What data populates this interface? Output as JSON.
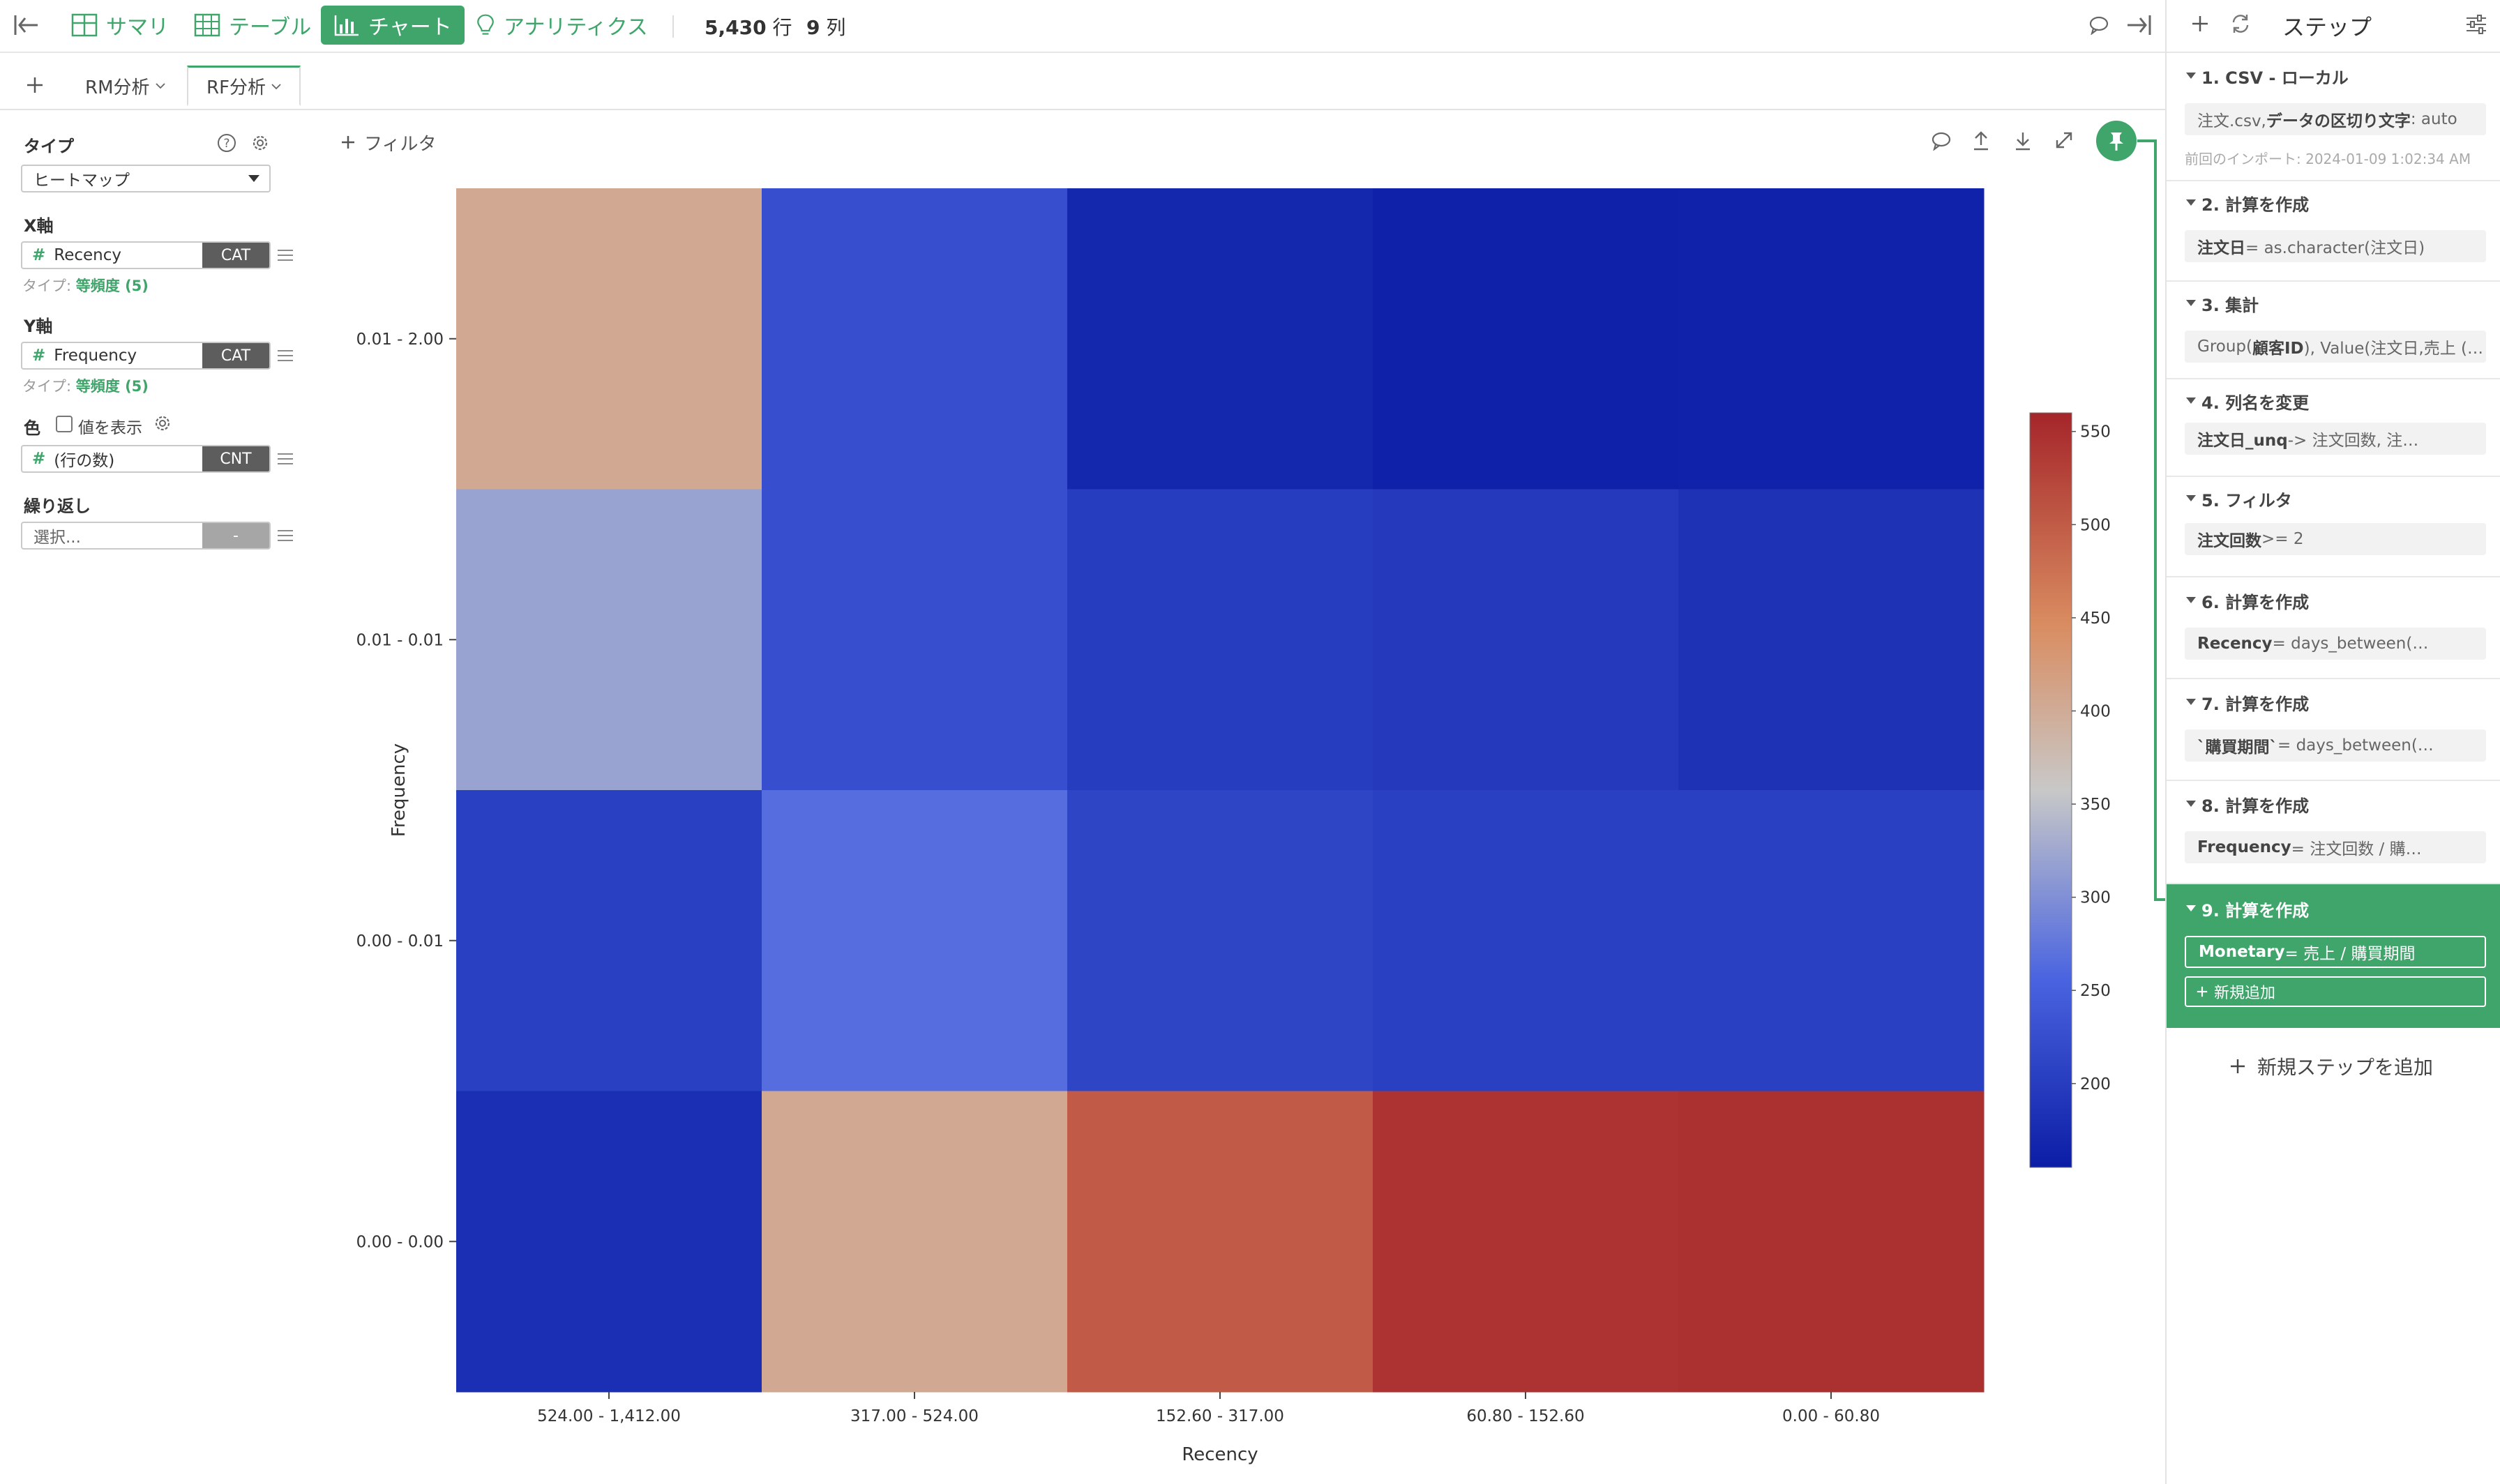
{
  "toolbar": {
    "nav": [
      {
        "label": "サマリ",
        "icon": "summary-icon"
      },
      {
        "label": "テーブル",
        "icon": "table-icon"
      },
      {
        "label": "チャート",
        "icon": "chart-icon",
        "active": true
      },
      {
        "label": "アナリティクス",
        "icon": "lightbulb-icon"
      }
    ],
    "rows_value": "5,430",
    "rows_unit": "行",
    "cols_value": "9",
    "cols_unit": "列"
  },
  "tabs": [
    {
      "label": "RM分析"
    },
    {
      "label": "RF分析",
      "active": true
    }
  ],
  "config": {
    "type_label": "タイプ",
    "type_value": "ヒートマップ",
    "x_label": "X軸",
    "x_field": "Recency",
    "x_tag": "CAT",
    "x_sub_prefix": "タイプ:",
    "x_sub_value": "等頻度 (5)",
    "y_label": "Y軸",
    "y_field": "Frequency",
    "y_tag": "CAT",
    "y_sub_prefix": "タイプ:",
    "y_sub_value": "等頻度 (5)",
    "color_label": "色",
    "show_values_label": "値を表示",
    "color_field": "(行の数)",
    "color_tag": "CNT",
    "repeat_label": "繰り返し",
    "repeat_placeholder": "選択...",
    "repeat_tag": "-"
  },
  "chart_toolbar": {
    "filter_label": "フィルタ"
  },
  "chart_data": {
    "type": "heatmap",
    "xlabel": "Recency",
    "ylabel": "Frequency",
    "x_categories": [
      "524.00 - 1,412.00",
      "317.00 - 524.00",
      "152.60 - 317.00",
      "60.80 - 152.60",
      "0.00 - 60.80"
    ],
    "y_categories": [
      "0.01 - 2.00",
      "0.01 - 0.01",
      "0.00 - 0.01",
      "0.00 - 0.00"
    ],
    "values": [
      [
        405,
        225,
        170,
        160,
        162
      ],
      [
        320,
        225,
        200,
        195,
        185
      ],
      [
        205,
        265,
        212,
        205,
        205
      ],
      [
        180,
        405,
        500,
        545,
        548
      ]
    ],
    "colorbar": {
      "min": 155,
      "max": 560,
      "ticks": [
        550,
        500,
        450,
        400,
        350,
        300,
        250,
        200
      ]
    },
    "colors": {
      "low": "#0b1da5",
      "mid": "#c8c8c8",
      "high": "#a5252a"
    }
  },
  "steps_panel": {
    "title": "ステップ",
    "add_step_label": "新規ステップを追加",
    "steps": [
      {
        "title": "1. CSV - ローカル",
        "body_pre": "注文.csv, ",
        "body_bold": "データの区切り文字",
        "body_post": ": auto",
        "meta": "前回のインポート: 2024-01-09 1:02:34 AM"
      },
      {
        "title": "2. 計算を作成",
        "body_pre": "",
        "body_bold": "注文日",
        "body_post": " = as.character(注文日)"
      },
      {
        "title": "3. 集計",
        "body_pre": "Group(",
        "body_bold": "顧客ID",
        "body_post": "), Value(注文日,売上 (…"
      },
      {
        "title": "4. 列名を変更",
        "body_pre": "",
        "body_bold": "注文日_unq",
        "body_post": " -> 注文回数, 注…"
      },
      {
        "title": "5. フィルタ",
        "body_pre": "",
        "body_bold": "注文回数",
        "body_post": " >= 2"
      },
      {
        "title": "6. 計算を作成",
        "body_pre": "",
        "body_bold": "Recency",
        "body_post": " = days_between(…"
      },
      {
        "title": "7. 計算を作成",
        "body_pre": "",
        "body_bold": "`購買期間`",
        "body_post": " = days_between(…"
      },
      {
        "title": "8. 計算を作成",
        "body_pre": "",
        "body_bold": "Frequency",
        "body_post": " = 注文回数 / 購…"
      },
      {
        "title": "9. 計算を作成",
        "body_pre": "",
        "body_bold": "Monetary",
        "body_post": " = 売上 / 購買期間",
        "active": true,
        "add_label": "新規追加"
      }
    ]
  }
}
